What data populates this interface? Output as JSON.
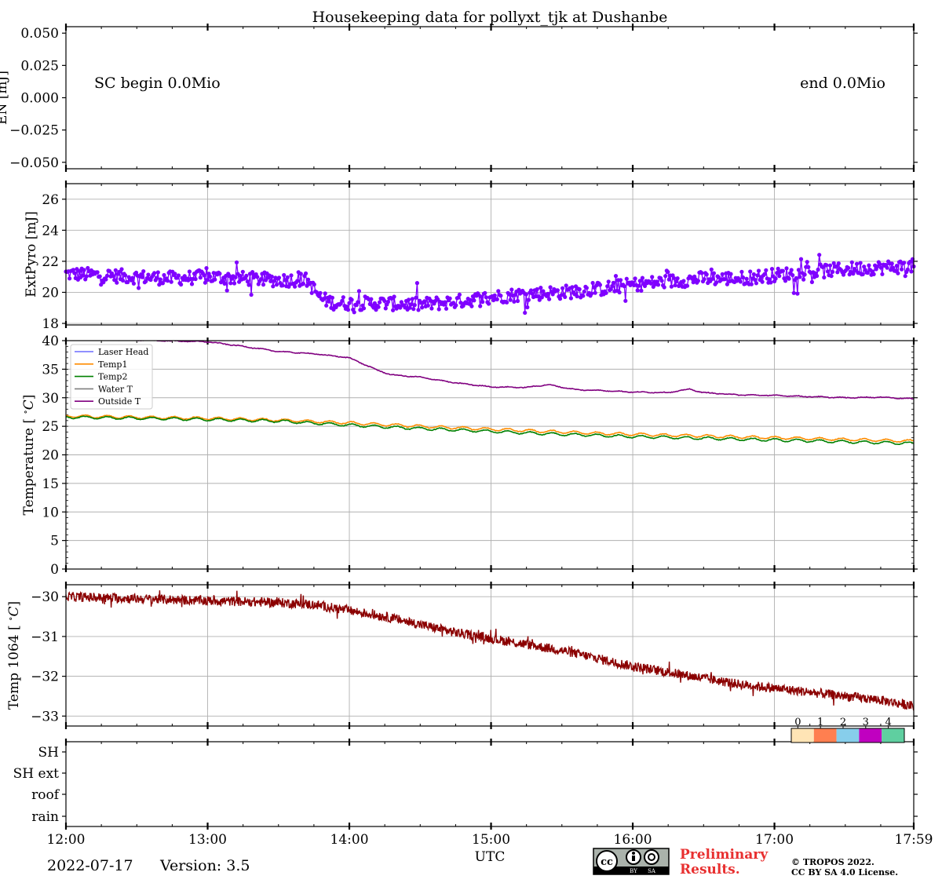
{
  "title": "Housekeeping data for pollyxt_tjk at Dushanbe",
  "footer": {
    "date": "2022-07-17",
    "version": "Version: 3.5",
    "preliminary_line1": "Preliminary",
    "preliminary_line2": "Results.",
    "copyright_line1": "© TROPOS 2022.",
    "copyright_line2": "CC BY SA 4.0 License.",
    "cc_badge_by": "BY",
    "cc_badge_sa": "SA"
  },
  "colors": {
    "extpyro": "#7f00ff",
    "laser_head": "#6b6bff",
    "temp1": "#ff8c00",
    "temp2": "#008000",
    "water_t": "#7f7f7f",
    "outside_t": "#800080",
    "temp1064": "#8b0000",
    "grid": "#b0b0b0",
    "preliminary": "#e83030"
  },
  "x_axis": {
    "label": "UTC",
    "ticks": [
      "12:00",
      "13:00",
      "14:00",
      "15:00",
      "16:00",
      "17:00",
      "17:59"
    ],
    "tick_values_hours": [
      12,
      13,
      14,
      15,
      16,
      17,
      17.983
    ]
  },
  "chart_data": [
    {
      "type": "line",
      "panel": "EN",
      "ylabel": "EN [mJ]",
      "ylim": [
        -0.055,
        0.055
      ],
      "yticks": [
        0.05,
        0.025,
        0.0,
        -0.025,
        -0.05
      ],
      "ytick_labels": [
        "0.050",
        "0.025",
        "0.000",
        "−0.025",
        "−0.050"
      ],
      "grid": false,
      "annotations": [
        "SC begin 0.0Mio",
        "end 0.0Mio"
      ],
      "series": []
    },
    {
      "type": "scatter",
      "panel": "ExtPyro",
      "ylabel": "ExtPyro [mJ]",
      "ylim": [
        17.9,
        27
      ],
      "yticks": [
        18,
        20,
        22,
        24,
        26
      ],
      "grid": true,
      "series": [
        {
          "x": [
            12.0,
            12.25,
            12.5,
            12.75,
            13.0,
            13.25,
            13.5,
            13.7,
            13.8,
            13.9,
            14.0,
            14.25,
            14.5,
            14.75,
            15.0,
            15.25,
            15.5,
            15.75,
            16.0,
            16.25,
            16.5,
            16.75,
            17.0,
            17.25,
            17.5,
            17.75,
            17.98
          ],
          "values": [
            21.2,
            21.1,
            21.0,
            20.9,
            21.0,
            20.9,
            20.8,
            20.8,
            19.6,
            19.3,
            19.3,
            19.3,
            19.2,
            19.4,
            19.7,
            19.9,
            20.0,
            20.2,
            20.5,
            20.7,
            20.9,
            20.9,
            21.1,
            21.3,
            21.5,
            21.6,
            21.7
          ],
          "noise": 0.45
        }
      ]
    },
    {
      "type": "line",
      "panel": "Temperature",
      "ylabel": "Temperature [$^\\circ C$]",
      "ylim": [
        0,
        40
      ],
      "yticks": [
        0,
        5,
        10,
        15,
        20,
        25,
        30,
        35,
        40
      ],
      "grid": true,
      "legend_position": "upper-left",
      "series": [
        {
          "name": "Laser Head",
          "x": [],
          "values": []
        },
        {
          "name": "Temp1",
          "x": [
            12.0,
            12.5,
            13.0,
            13.5,
            14.0,
            14.5,
            15.0,
            15.5,
            16.0,
            16.5,
            17.0,
            17.5,
            17.98
          ],
          "values": [
            26.8,
            26.6,
            26.4,
            26.1,
            25.6,
            25.0,
            24.5,
            24.0,
            23.6,
            23.3,
            23.0,
            22.7,
            22.4
          ]
        },
        {
          "name": "Temp2",
          "x": [
            12.0,
            12.5,
            13.0,
            13.5,
            14.0,
            14.5,
            15.0,
            15.5,
            16.0,
            16.5,
            17.0,
            17.5,
            17.98
          ],
          "values": [
            26.6,
            26.4,
            26.2,
            25.9,
            25.2,
            24.6,
            24.1,
            23.6,
            23.2,
            22.9,
            22.6,
            22.3,
            22.0
          ]
        },
        {
          "name": "Water T",
          "x": [],
          "values": []
        },
        {
          "name": "Outside T",
          "x": [
            12.0,
            12.5,
            13.0,
            13.25,
            13.5,
            13.75,
            14.0,
            14.1,
            14.2,
            14.3,
            14.5,
            14.75,
            15.0,
            15.25,
            15.4,
            15.6,
            15.75,
            16.0,
            16.25,
            16.4,
            16.5,
            16.75,
            17.0,
            17.25,
            17.5,
            17.75,
            17.98
          ],
          "values": [
            40.3,
            40.1,
            39.8,
            39.0,
            38.1,
            37.7,
            37.0,
            35.9,
            34.8,
            34.0,
            33.6,
            32.6,
            31.9,
            31.8,
            32.3,
            31.4,
            31.3,
            31.0,
            30.9,
            31.5,
            30.9,
            30.5,
            30.4,
            30.2,
            30.0,
            30.1,
            29.8
          ]
        }
      ]
    },
    {
      "type": "line",
      "panel": "Temp1064",
      "ylabel": "Temp 1064 [$^\\circ C$]",
      "ylim": [
        -33.25,
        -29.7
      ],
      "yticks": [
        -30,
        -31,
        -32,
        -33
      ],
      "ytick_labels": [
        "−30",
        "−31",
        "−32",
        "−33"
      ],
      "grid": true,
      "series": [
        {
          "x": [
            12.0,
            12.5,
            13.0,
            13.5,
            13.75,
            14.0,
            14.25,
            14.5,
            14.75,
            15.0,
            15.25,
            15.5,
            15.75,
            16.0,
            16.25,
            16.5,
            16.75,
            17.0,
            17.25,
            17.5,
            17.75,
            17.98
          ],
          "values": [
            -30.0,
            -30.05,
            -30.1,
            -30.15,
            -30.2,
            -30.35,
            -30.5,
            -30.7,
            -30.9,
            -31.05,
            -31.2,
            -31.35,
            -31.55,
            -31.75,
            -31.9,
            -32.05,
            -32.2,
            -32.3,
            -32.4,
            -32.5,
            -32.6,
            -32.75
          ]
        }
      ]
    },
    {
      "type": "heatmap",
      "panel": "Status",
      "ylabels": [
        "SH",
        "SH ext",
        "roof",
        "rain"
      ],
      "colorbar": {
        "ticks": [
          "0",
          "1",
          "2",
          "3",
          "4"
        ],
        "colors": [
          "#ffe4b5",
          "#ff7f50",
          "#87ceeb",
          "#c000c0",
          "#5fcfa0"
        ]
      },
      "values": []
    }
  ]
}
